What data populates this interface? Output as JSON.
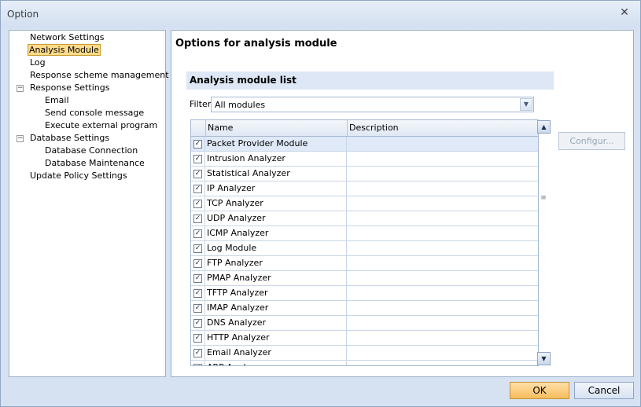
{
  "window": {
    "title": "Option"
  },
  "tree": {
    "items": [
      {
        "label": "Network Settings"
      },
      {
        "label": "Analysis Module"
      },
      {
        "label": "Log"
      },
      {
        "label": "Response scheme management"
      },
      {
        "label": "Response Settings"
      },
      {
        "label": "Email"
      },
      {
        "label": "Send console message"
      },
      {
        "label": "Execute external program"
      },
      {
        "label": "Database Settings"
      },
      {
        "label": "Database Connection"
      },
      {
        "label": "Database Maintenance"
      },
      {
        "label": "Update Policy Settings"
      }
    ],
    "selected": "Analysis Module",
    "expander_symbol": "−"
  },
  "content": {
    "title": "Options for analysis module",
    "section_header": "Analysis module list",
    "filter_label": "Filter",
    "filter_value": "All modules",
    "columns": {
      "name": "Name",
      "description": "Description"
    },
    "rows": [
      {
        "name": "Packet Provider Module",
        "description": "",
        "checked": true
      },
      {
        "name": "Intrusion Analyzer",
        "description": "",
        "checked": true
      },
      {
        "name": "Statistical Analyzer",
        "description": "",
        "checked": true
      },
      {
        "name": "IP Analyzer",
        "description": "",
        "checked": true
      },
      {
        "name": "TCP Analyzer",
        "description": "",
        "checked": true
      },
      {
        "name": "UDP Analyzer",
        "description": "",
        "checked": true
      },
      {
        "name": "ICMP Analyzer",
        "description": "",
        "checked": true
      },
      {
        "name": "Log Module",
        "description": "",
        "checked": true
      },
      {
        "name": "FTP Analyzer",
        "description": "",
        "checked": true
      },
      {
        "name": "PMAP Analyzer",
        "description": "",
        "checked": true
      },
      {
        "name": "TFTP Analyzer",
        "description": "",
        "checked": true
      },
      {
        "name": "IMAP Analyzer",
        "description": "",
        "checked": true
      },
      {
        "name": "DNS Analyzer",
        "description": "",
        "checked": true
      },
      {
        "name": "HTTP Analyzer",
        "description": "",
        "checked": true
      },
      {
        "name": "Email Analyzer",
        "description": "",
        "checked": true
      },
      {
        "name": "ARP Analyzer",
        "description": "",
        "checked": true
      }
    ],
    "configure_label": "Configur...",
    "check_symbol": "✓"
  },
  "footer": {
    "ok_label": "OK",
    "cancel_label": "Cancel"
  },
  "icons": {
    "close": "close-icon",
    "dropdown": "chevron-down-icon",
    "scroll_up": "scroll-up-icon",
    "scroll_down": "scroll-down-icon",
    "scroll_grip": "grip-icon"
  }
}
